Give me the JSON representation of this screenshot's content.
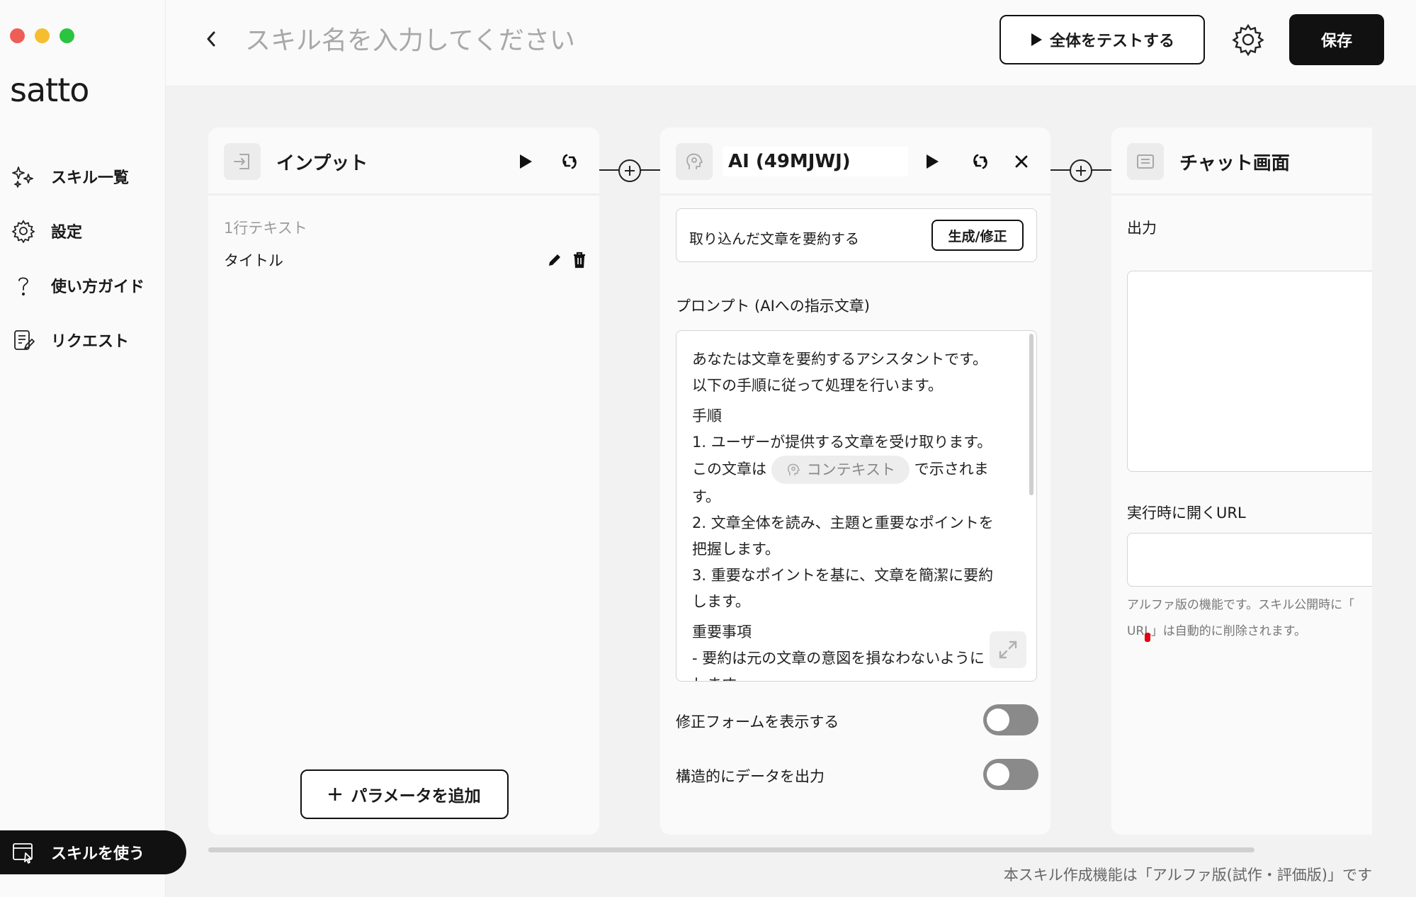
{
  "app": {
    "name": "satto"
  },
  "sidebar": {
    "items": [
      {
        "label": "スキル一覧",
        "icon": "sparkles-icon"
      },
      {
        "label": "設定",
        "icon": "gear-icon"
      },
      {
        "label": "使い方ガイド",
        "icon": "question-icon"
      },
      {
        "label": "リクエスト",
        "icon": "request-edit-icon"
      }
    ],
    "use_skill_label": "スキルを使う"
  },
  "header": {
    "skill_name_placeholder": "スキル名を入力してください",
    "test_all_label": "全体をテストする",
    "save_label": "保存"
  },
  "nodes": {
    "input": {
      "title": "インプット",
      "param_type": "1行テキスト",
      "param_name": "タイトル",
      "add_param_label": "パラメータを追加"
    },
    "ai": {
      "title": "AI (49MJWJ)",
      "summary": "取り込んだ文章を要約する",
      "generate_label": "生成/修正",
      "prompt_label": "プロンプト (AIへの指示文章)",
      "prompt": {
        "line1": "あなたは文章を要約するアシスタントです。",
        "line2": "以下の手順に従って処理を行います。",
        "heading1": "手順",
        "step1": "1. ユーザーが提供する文章を受け取ります。",
        "step1b_pre": "この文章は",
        "chip": "コンテキスト",
        "step1b_post": "で示されま",
        "step1c": "す。",
        "step2": "2. 文章全体を読み、主題と重要なポイントを",
        "step2b": "把握します。",
        "step3": "3. 重要なポイントを基に、文章を簡潔に要約",
        "step3b": "します。",
        "heading2": "重要事項",
        "note1": "- 要約は元の文章の意図を損なわないように",
        "note1b": "します。"
      },
      "toggle_fix_form": {
        "label": "修正フォームを表示する",
        "on": false
      },
      "toggle_structured": {
        "label": "構造的にデータを出力",
        "on": false
      }
    },
    "chat": {
      "title": "チャット画面",
      "output_label": "出力",
      "url_label": "実行時に開くURL",
      "url_value": "",
      "alpha_note_1": "アルファ版の機能です。スキル公開時に「",
      "alpha_note_2": "URL」は自動的に削除されます。"
    }
  },
  "footer": {
    "note": "本スキル作成機能は「アルファ版(試作・評価版)」です"
  }
}
